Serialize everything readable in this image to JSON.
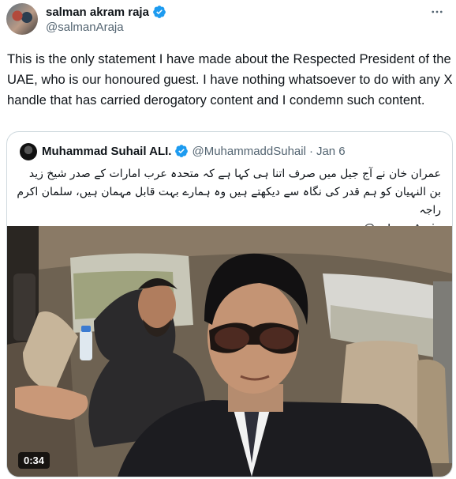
{
  "author": {
    "display_name": "salman akram raja",
    "handle": "@salmanAraja",
    "verified": true
  },
  "more_icon": "more-horizontal-icon",
  "tweet": {
    "text": "This is the only statement I have made about the Respected President of the UAE, who is our honoured guest. I have nothing whatsoever to do with any X handle that has carried derogatory content and I condemn such content."
  },
  "quote": {
    "display_name": "Muhammad Suhail ALI.",
    "handle": "@MuhammaddSuhail",
    "separator": "·",
    "date": "Jan 6",
    "text": "عمران خان نے آج جیل میں صرف اتنا ہی کہا ہے کہ متحدہ عرب امارات کے صدر شیخ زید بن النہیان کو ہم قدر کی نگاہ سے دیکھتے ہیں وہ ہمارے بہت قابل مہمان ہیں، سلمان اکرم راجہ",
    "mention": "@salmanAraja",
    "video": {
      "duration": "0:34"
    }
  },
  "colors": {
    "verified_blue": "#1d9bf0",
    "secondary_text": "#536471",
    "border": "#cfd9de"
  }
}
